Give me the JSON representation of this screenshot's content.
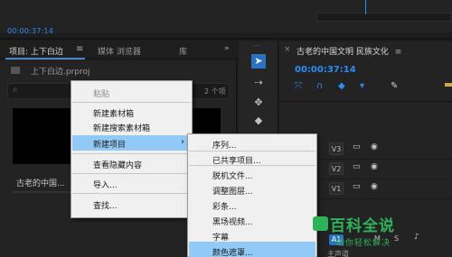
{
  "top": {
    "timecode": "00:00:37:14"
  },
  "project_panel": {
    "tab_project": "项目: 上下白边",
    "tab_menu_icon": "≡",
    "tab_media_browser": "媒体 浏览器",
    "tab_library": "库",
    "tab_overflow": "»",
    "file_name": "上下白边.prproj",
    "item_count": "2 个项",
    "thumbnail_label": "古老的中国..."
  },
  "tools": {
    "icons": [
      "selection-tool-icon",
      "track-select-icon",
      "ripple-edit-icon",
      "razor-icon"
    ]
  },
  "timeline": {
    "close_glyph": "×",
    "title": "古老的中国文明 民族文化",
    "menu_glyph": "≡",
    "timecode": "00:00:37:14",
    "tracks": [
      "V3",
      "V2",
      "V1",
      "A1"
    ],
    "a1_mute": "M",
    "a1_solo": "S",
    "master_label": "主声道"
  },
  "context_menu": {
    "items": [
      {
        "label": "粘贴",
        "enabled": false
      },
      {
        "label": "新建素材箱",
        "enabled": true
      },
      {
        "label": "新建搜索素材箱",
        "enabled": true
      },
      {
        "label": "新建项目",
        "enabled": true,
        "highlighted": true,
        "submenu_arrow": "›"
      },
      {
        "label": "查看隐藏内容",
        "enabled": true
      },
      {
        "label": "导入...",
        "enabled": true
      },
      {
        "label": "查找...",
        "enabled": true
      }
    ]
  },
  "submenu": {
    "items": [
      {
        "label": "序列...",
        "highlighted": false
      },
      {
        "label": "已共享项目...",
        "highlighted": false
      },
      {
        "label": "脱机文件...",
        "highlighted": false
      },
      {
        "label": "调整图层...",
        "highlighted": false
      },
      {
        "label": "彩条...",
        "highlighted": false
      },
      {
        "label": "黑场视频...",
        "highlighted": false
      },
      {
        "label": "字幕",
        "highlighted": false
      },
      {
        "label": "颜色遮罩...",
        "highlighted": true
      }
    ]
  },
  "watermark": {
    "title": "百科全说",
    "subtitle": "助你轻松解决"
  },
  "colors": {
    "accent_blue": "#2b8df7",
    "menu_highlight": "#91c9f7",
    "watermark_green": "#2db35a"
  }
}
